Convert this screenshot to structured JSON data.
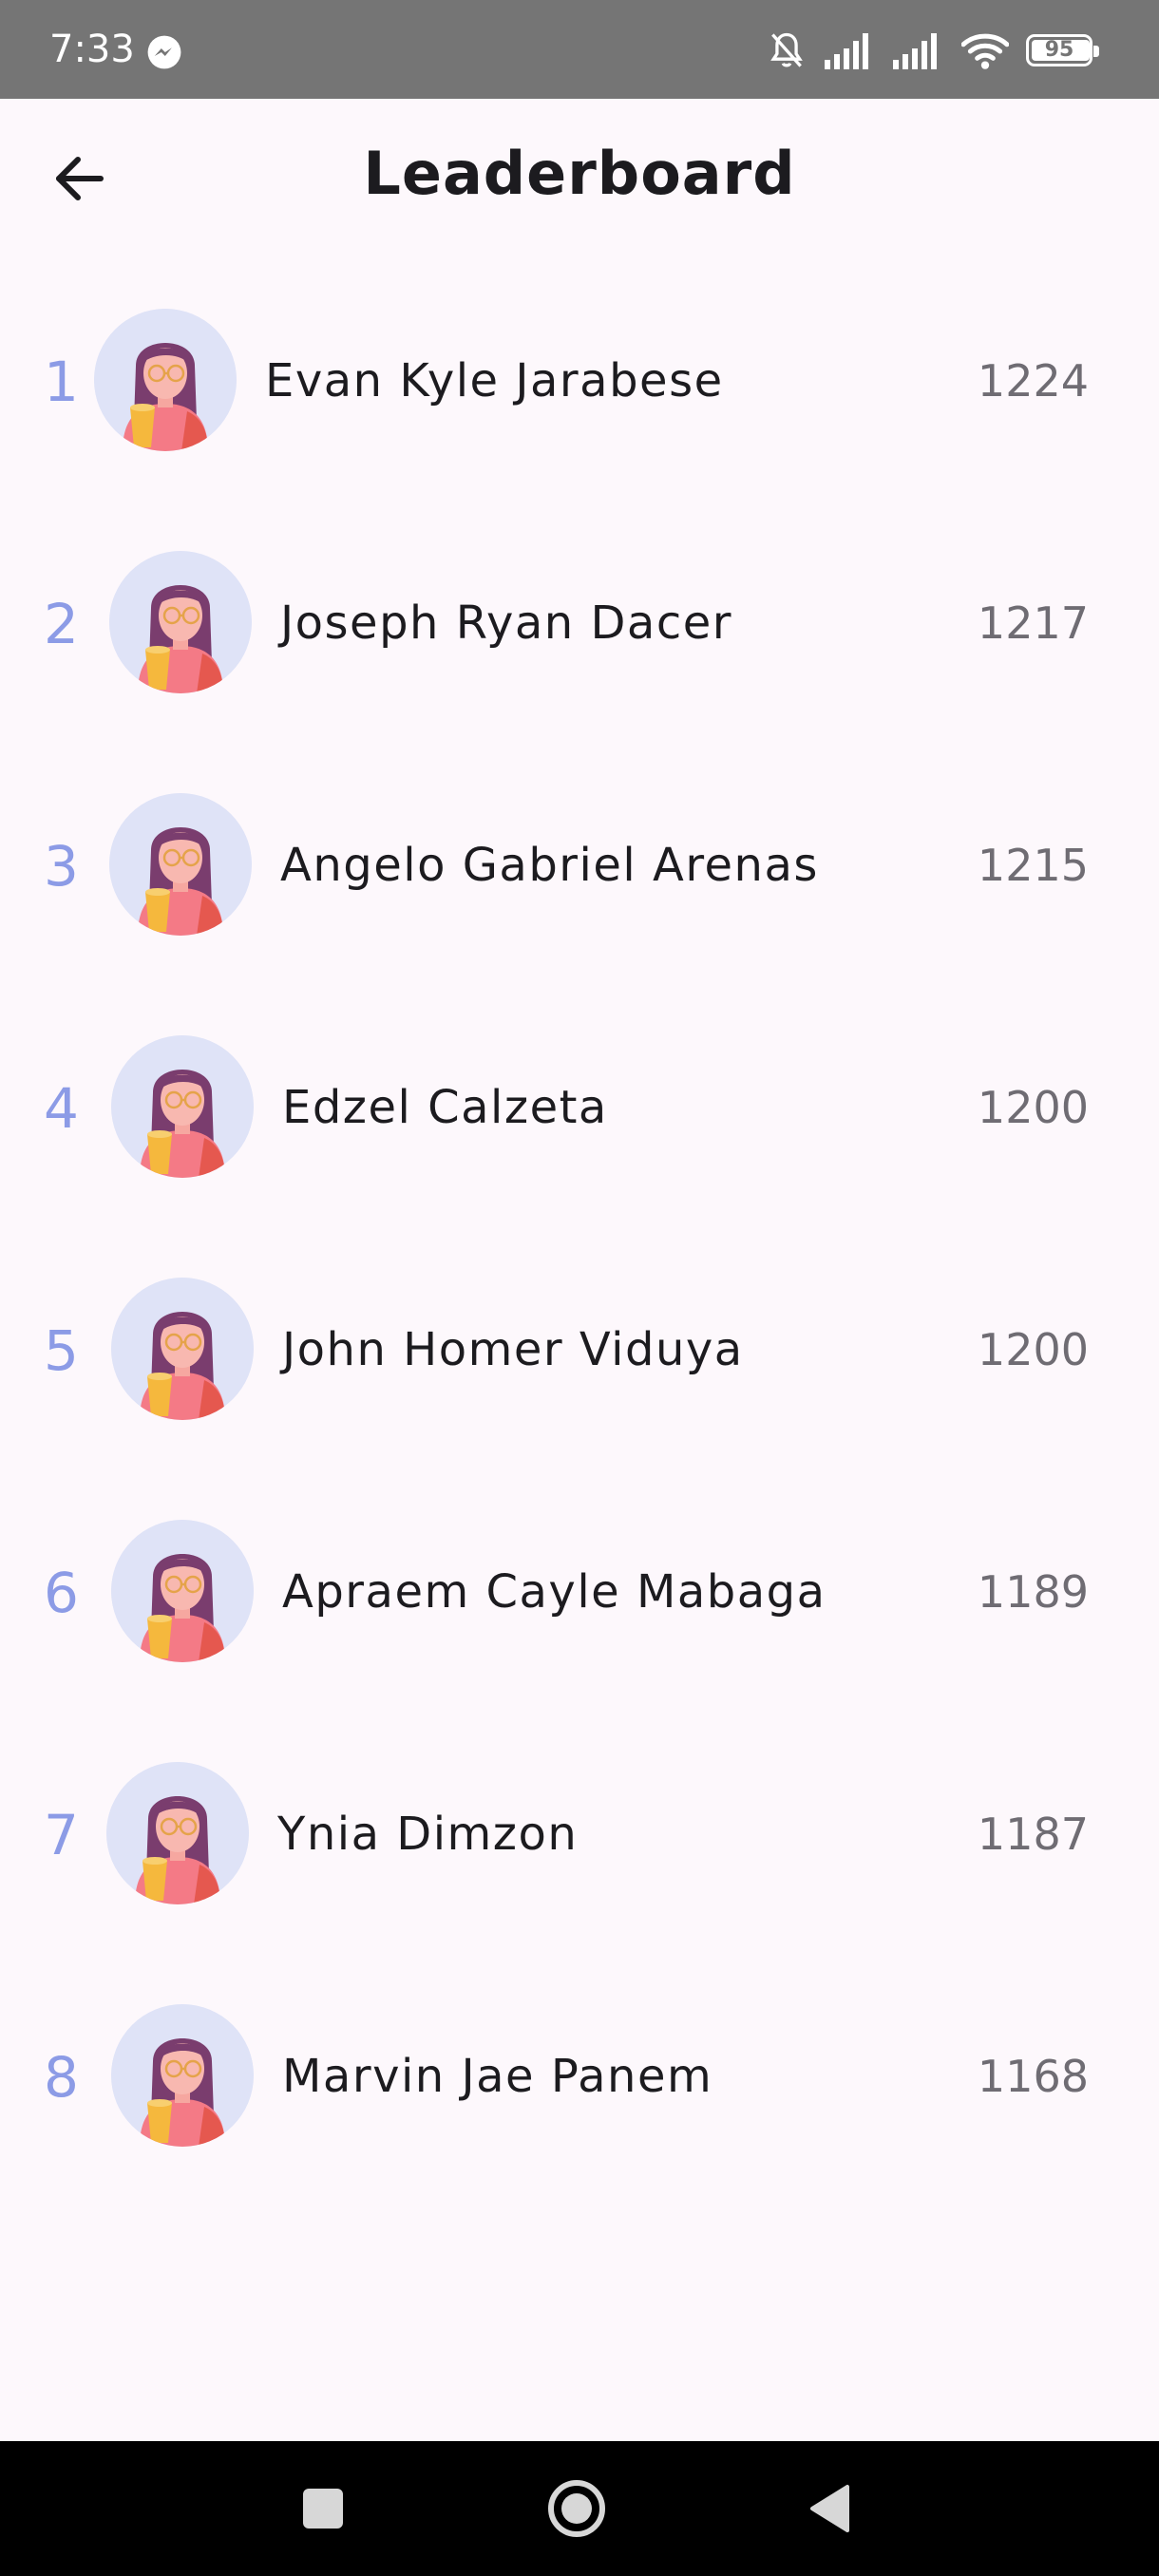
{
  "status_bar": {
    "time": "7:33",
    "battery_level": "95",
    "icons": [
      "messenger-icon",
      "bell-off-icon",
      "signal-icon",
      "signal-icon",
      "wifi-icon",
      "battery-icon"
    ]
  },
  "header": {
    "title": "Leaderboard",
    "back_icon": "arrow-left-icon"
  },
  "leaderboard": [
    {
      "rank": "1",
      "name": "Evan Kyle Jarabese",
      "score": "1224"
    },
    {
      "rank": "2",
      "name": "Joseph Ryan Dacer",
      "score": "1217"
    },
    {
      "rank": "3",
      "name": "Angelo Gabriel Arenas",
      "score": "1215"
    },
    {
      "rank": "4",
      "name": "Edzel Calzeta",
      "score": "1200"
    },
    {
      "rank": "5",
      "name": "John Homer Viduya",
      "score": "1200"
    },
    {
      "rank": "6",
      "name": "Apraem Cayle Mabaga",
      "score": "1189"
    },
    {
      "rank": "7",
      "name": "Ynia Dimzon",
      "score": "1187"
    },
    {
      "rank": "8",
      "name": "Marvin Jae Panem",
      "score": "1168"
    }
  ],
  "nav_bar": {
    "icons": [
      "recents-square-icon",
      "home-circle-icon",
      "back-triangle-icon"
    ]
  },
  "colors": {
    "background": "#fdf8fc",
    "rank": "#8c9be6",
    "name": "#1c1b1f",
    "score": "#6f6c73",
    "status_bar": "#757575",
    "avatar_bg": "#dfe3f7"
  }
}
